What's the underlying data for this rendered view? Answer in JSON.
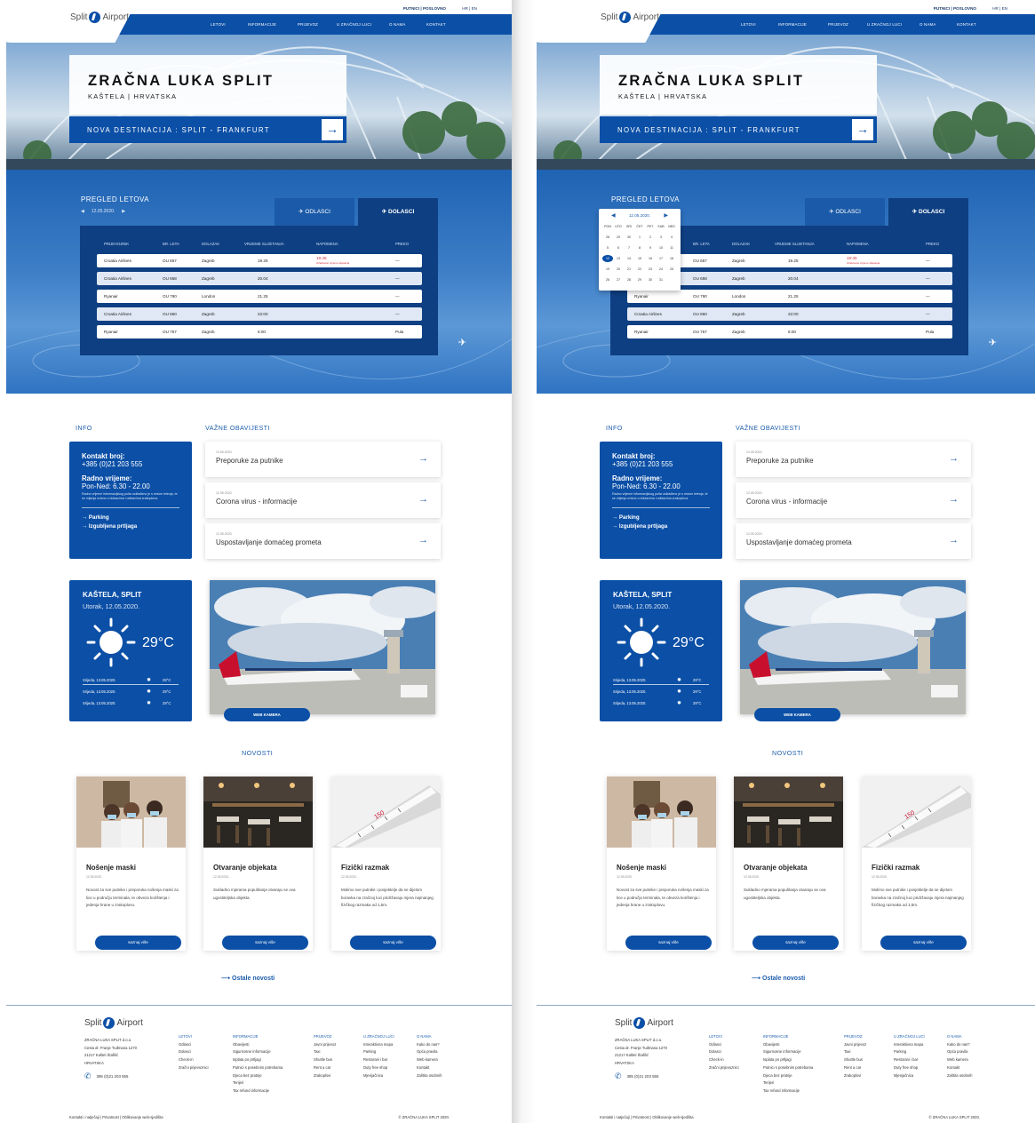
{
  "top": {
    "links": "PUTNICI | POSLOVNO",
    "lang": "HR  |  EN"
  },
  "logo": {
    "left_text": "Split",
    "right_text": "Airport"
  },
  "nav": [
    "LETOVI",
    "INFORMACIJE",
    "PRIJEVOZ",
    "U ZRAČNOJ LUCI",
    "O NAMA",
    "KONTAKT"
  ],
  "hero": {
    "title": "ZRAČNA LUKA SPLIT",
    "subtitle": "KAŠTELA | HRVATSKA",
    "destination": "NOVA DESTINACIJA : SPLIT - FRANKFURT",
    "arrow": "→"
  },
  "flights": {
    "title": "PREGLED LETOVA",
    "date": "12.05.2020.",
    "prev": "◀",
    "next": "▶",
    "tab_departures": "ODLASCI",
    "tab_arrivals": "DOLASCI",
    "columns": [
      "PRIJEVOZNIK",
      "BR. LETA",
      "DOLAZAK",
      "VRIJEME SLIJETANJA",
      "NAPOMENA",
      "PREKO"
    ],
    "rows": [
      [
        "Croatia Airlines",
        "OU 657",
        "Zagreb",
        "19.25",
        "19:45",
        "—"
      ],
      [
        "Croatia Airlines",
        "OU 658",
        "Zagreb",
        "20.04",
        "",
        "—"
      ],
      [
        "Ryanair",
        "OU 790",
        "London",
        "21.25",
        "",
        "—"
      ],
      [
        "Croatia Airlines",
        "OU 860",
        "Zagreb",
        "22:00",
        "",
        "—"
      ],
      [
        "Ryanair",
        "OU 757",
        "Zagreb",
        "6:00",
        "",
        "Pula"
      ]
    ],
    "delay_note": "Očekivano vrijeme slijetanja"
  },
  "calendar": {
    "month": "12.05.2020.",
    "days": [
      "PON",
      "UTO",
      "SRI",
      "ČET",
      "PET",
      "SUB",
      "NED"
    ],
    "weeks": [
      [
        "28",
        "29",
        "30",
        "1",
        "2",
        "3",
        "4"
      ],
      [
        "5",
        "6",
        "7",
        "8",
        "9",
        "10",
        "11"
      ],
      [
        "12",
        "13",
        "14",
        "15",
        "16",
        "17",
        "18"
      ],
      [
        "19",
        "20",
        "21",
        "22",
        "23",
        "24",
        "25"
      ],
      [
        "26",
        "27",
        "28",
        "29",
        "30",
        "31",
        ""
      ]
    ],
    "selected": "12"
  },
  "info": {
    "label": "INFO",
    "contact_label": "Kontakt broj:",
    "contact_value": "+385 (0)21 203 555",
    "hours_label": "Radno vrijeme:",
    "hours_value": "Pon-Ned: 6.30 - 22.00",
    "hours_note": "Radno vrijeme informacijskog pulta usklađeno je s redom letenja, te se mijenja ovisno o dolascima i odlascima zrakoplova.",
    "links": [
      "→ Parking",
      "→ Izgubljena prtljaga"
    ]
  },
  "notices": {
    "label": "VAŽNE OBAVIJESTI",
    "items": [
      {
        "date": "12.05.2020.",
        "text": "Preporuke za putnike",
        "arrow": "→"
      },
      {
        "date": "12.05.2020.",
        "text": "Corona virus - informacije",
        "arrow": "→"
      },
      {
        "date": "12.05.2020.",
        "text": "Uspostavljanje domaćeg prometa",
        "arrow": "→"
      }
    ]
  },
  "weather": {
    "city": "KAŠTELA, SPLIT",
    "date": "Utorak, 12.05.2020.",
    "temp": "29°C",
    "forecast": [
      {
        "day": "Srijeda, 13.05.2020.",
        "temp": "29°C"
      },
      {
        "day": "Srijeda, 13.05.2020.",
        "temp": "29°C"
      },
      {
        "day": "Srijeda, 13.05.2020.",
        "temp": "29°C"
      }
    ]
  },
  "webcam": {
    "button": "WEB KAMERA"
  },
  "news": {
    "label": "NOVOSTI",
    "items": [
      {
        "title": "Nošenje maski",
        "date": "12.05.2020.",
        "text": "Novost za sve putnike i preporuka nošenja maski za lice u području terminala, te obveza korištenja i jedenja hrane u zrakoplovu.",
        "button": "saznaj više"
      },
      {
        "title": "Otvaranje objekata",
        "date": "12.05.2020.",
        "text": "Sukladno mjerama popuštanja otvaraju se ova ugostiteljska objekta.",
        "button": "saznaj više"
      },
      {
        "title": "Fizički razmak",
        "date": "12.05.2020.",
        "text": "Molimo sve putnike i posjetitelje da se dijelom boravka na zračnoj luci pridržavaju mjera najmanjeg fizičkog razmaka od 1,5m.",
        "button": "saznaj više"
      }
    ],
    "more": "Ostale novosti",
    "more_arrow": "⟶"
  },
  "footer": {
    "address": [
      "ZRAČNA LUKA SPLIT d.o.o.",
      "Cesta dr. Franje Tuđmana 1270",
      "21217 Kaštel Štafilić",
      "HRVATSKA"
    ],
    "phone": "385 (0)21 203 555",
    "columns": [
      {
        "head": "LETOVI",
        "items": [
          "Odlasci",
          "Dolasci",
          "Check-in",
          "Zračni prijevoznici"
        ]
      },
      {
        "head": "INFORMACIJE",
        "items": [
          "Obavijesti",
          "Sigurnosne informacije",
          "Isplata po prtljagi",
          "Putnici s posebnim potrebama",
          "Djeca bez pratnje",
          "Terijeri",
          "Tax refund informacije"
        ]
      },
      {
        "head": "PRIJEVOZ",
        "items": [
          "Javni prijevoz",
          "Taxi",
          "Shuttle bus",
          "Rent a car",
          "Zrakoplovi"
        ]
      },
      {
        "head": "U ZRAČNOJ LUCI",
        "items": [
          "Interaktivna mapa",
          "Parking",
          "Restorani i bar",
          "Duty free shop",
          "Mjenjačnica"
        ]
      },
      {
        "head": "O NAMA",
        "items": [
          "Kako do nas?",
          "Opća pravila",
          "Web kamera",
          "Kontakt",
          "Zaštita osobnih"
        ]
      }
    ],
    "bottom": "Kontakti i natječaji  |  Privatnost  |  Oblikovanje web-sjedišta",
    "copyright": "© ZRAČNA LUKA SPLIT 2020."
  }
}
